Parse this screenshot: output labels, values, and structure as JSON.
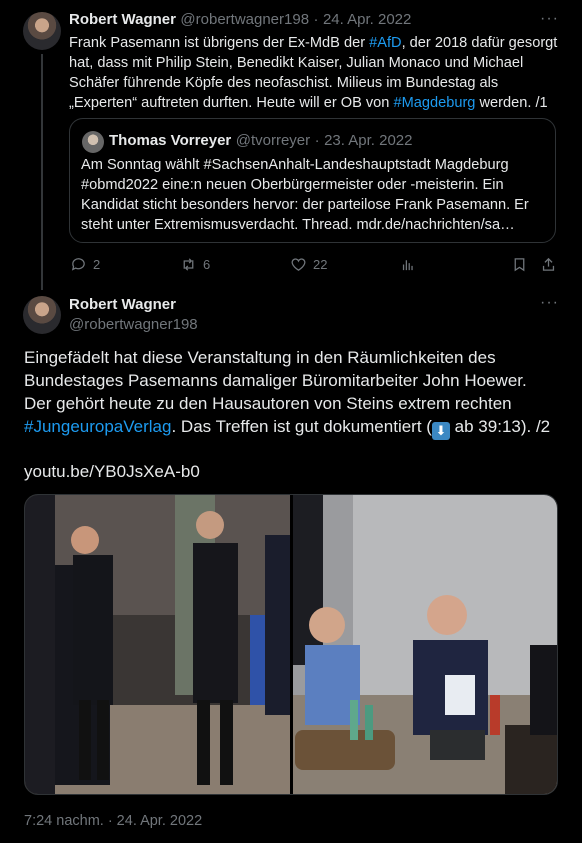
{
  "tweet1": {
    "name": "Robert Wagner",
    "handle": "@robertwagner198",
    "sep": "·",
    "date": "24. Apr. 2022",
    "more": "···",
    "text_parts": [
      {
        "t": "Frank Pasemann ist übrigens der Ex-MdB der ",
        "link": false
      },
      {
        "t": "#AfD",
        "link": true
      },
      {
        "t": ", der 2018 dafür gesorgt hat, dass mit Philip Stein, Benedikt Kaiser, Julian Monaco und Michael Schäfer führende Köpfe des neofaschist. Milieus im Bundestag als „Experten“ auftreten durften. Heute will er OB von ",
        "link": false
      },
      {
        "t": "#Magdeburg",
        "link": true
      },
      {
        "t": " werden. /1",
        "link": false
      }
    ],
    "quote": {
      "name": "Thomas Vorreyer",
      "handle": "@tvorreyer",
      "sep": "·",
      "date": "23. Apr. 2022",
      "text": "Am Sonntag wählt #SachsenAnhalt-Landeshauptstadt Magdeburg #obmd2022 eine:n neuen Oberbürgermeister oder -meisterin. Ein Kandidat sticht besonders hervor: der parteilose Frank Pasemann. Er steht unter Extremismusverdacht. Thread. mdr.de/nachrichten/sa…"
    },
    "actions": {
      "replies": "2",
      "retweets": "6",
      "likes": "22"
    }
  },
  "tweet2": {
    "name": "Robert Wagner",
    "handle": "@robertwagner198",
    "more": "···",
    "text_before": "Eingefädelt hat diese Veranstaltung in den Räumlichkeiten des Bundestages Pasemanns damaliger Büromitarbeiter John Hoewer. Der gehört heute zu den Hausautoren von Steins extrem rechten ",
    "hashtag": "#JungeuropaVerlag",
    "text_after": ". Das Treffen ist gut dokumentiert (",
    "emoji": "⬇",
    "text_end": " ab 39:13). /2",
    "link": "youtu.be/YB0JsXeA-b0",
    "timestamp": "7:24 nachm. · 24. Apr. 2022"
  },
  "icons": {
    "reply": "reply-icon",
    "retweet": "retweet-icon",
    "like": "heart-icon",
    "views": "views-icon",
    "bookmark": "bookmark-icon",
    "share": "share-icon"
  },
  "colors": {
    "background": "#000000",
    "text": "#e7e9ea",
    "muted": "#71767b",
    "link": "#1d9bf0",
    "border": "#2f3336"
  }
}
